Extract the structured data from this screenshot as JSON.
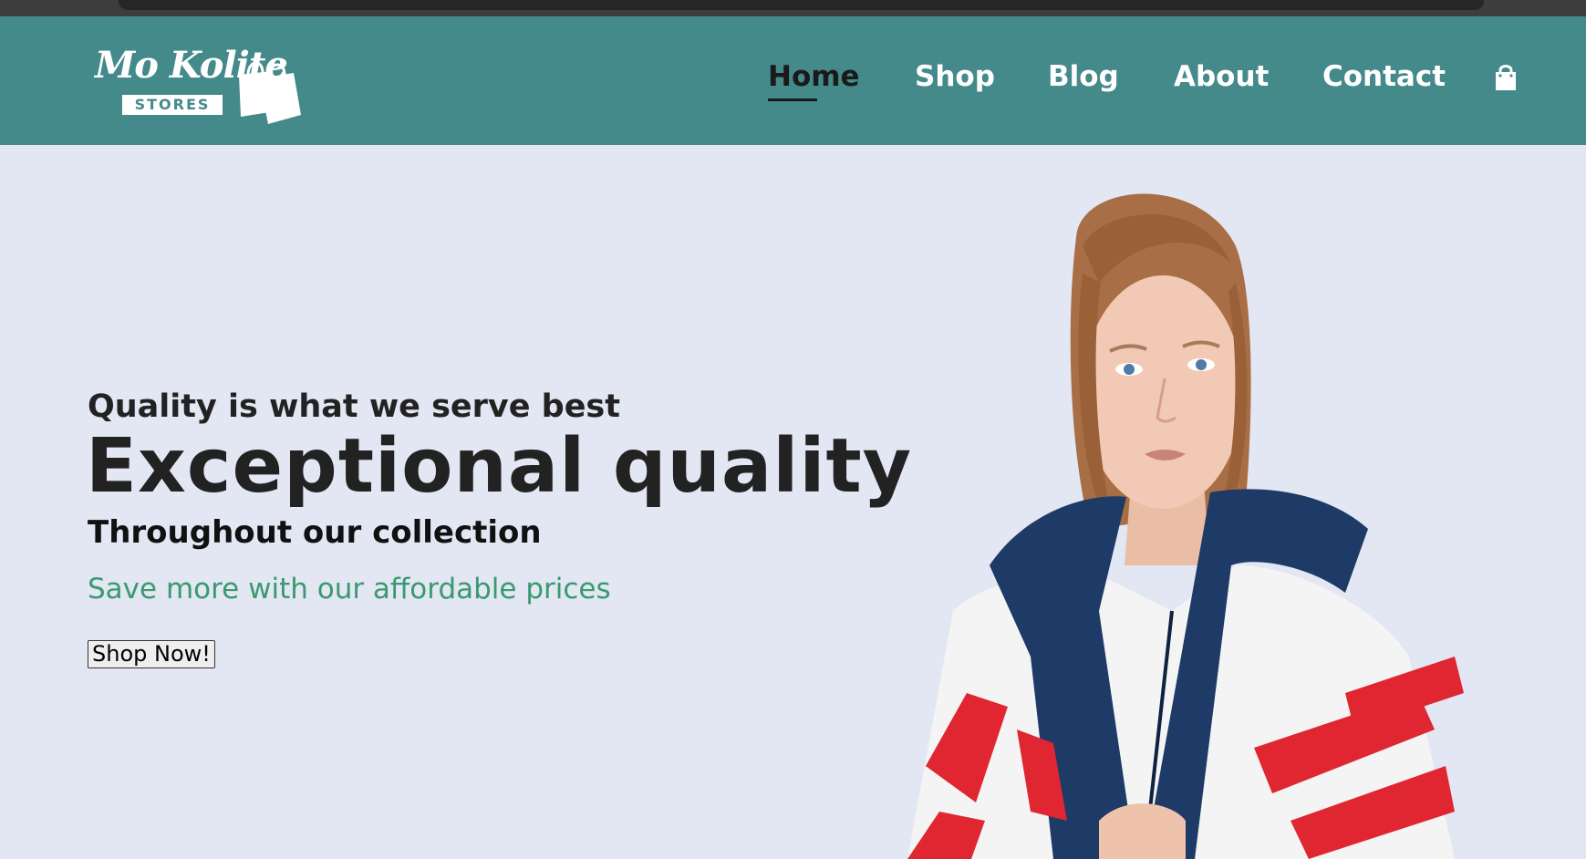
{
  "brand": {
    "name_script": "Mo Kolite",
    "name_tag": "STORES"
  },
  "nav": {
    "items": [
      {
        "label": "Home",
        "active": true
      },
      {
        "label": "Shop",
        "active": false
      },
      {
        "label": "Blog",
        "active": false
      },
      {
        "label": "About",
        "active": false
      },
      {
        "label": "Contact",
        "active": false
      }
    ],
    "cart_icon": "shopping-bag-icon"
  },
  "hero": {
    "subheading": "Quality is what we serve best",
    "title": "Exceptional quality",
    "title_line2": "Throughout our collection",
    "tagline": "Save more with our affordable prices",
    "cta_label": "Shop Now!",
    "image": "model in navy, red and white track jacket"
  },
  "colors": {
    "header_bg": "#458a8b",
    "hero_bg": "#e3e6f3",
    "accent_text": "#3a9a6e"
  }
}
